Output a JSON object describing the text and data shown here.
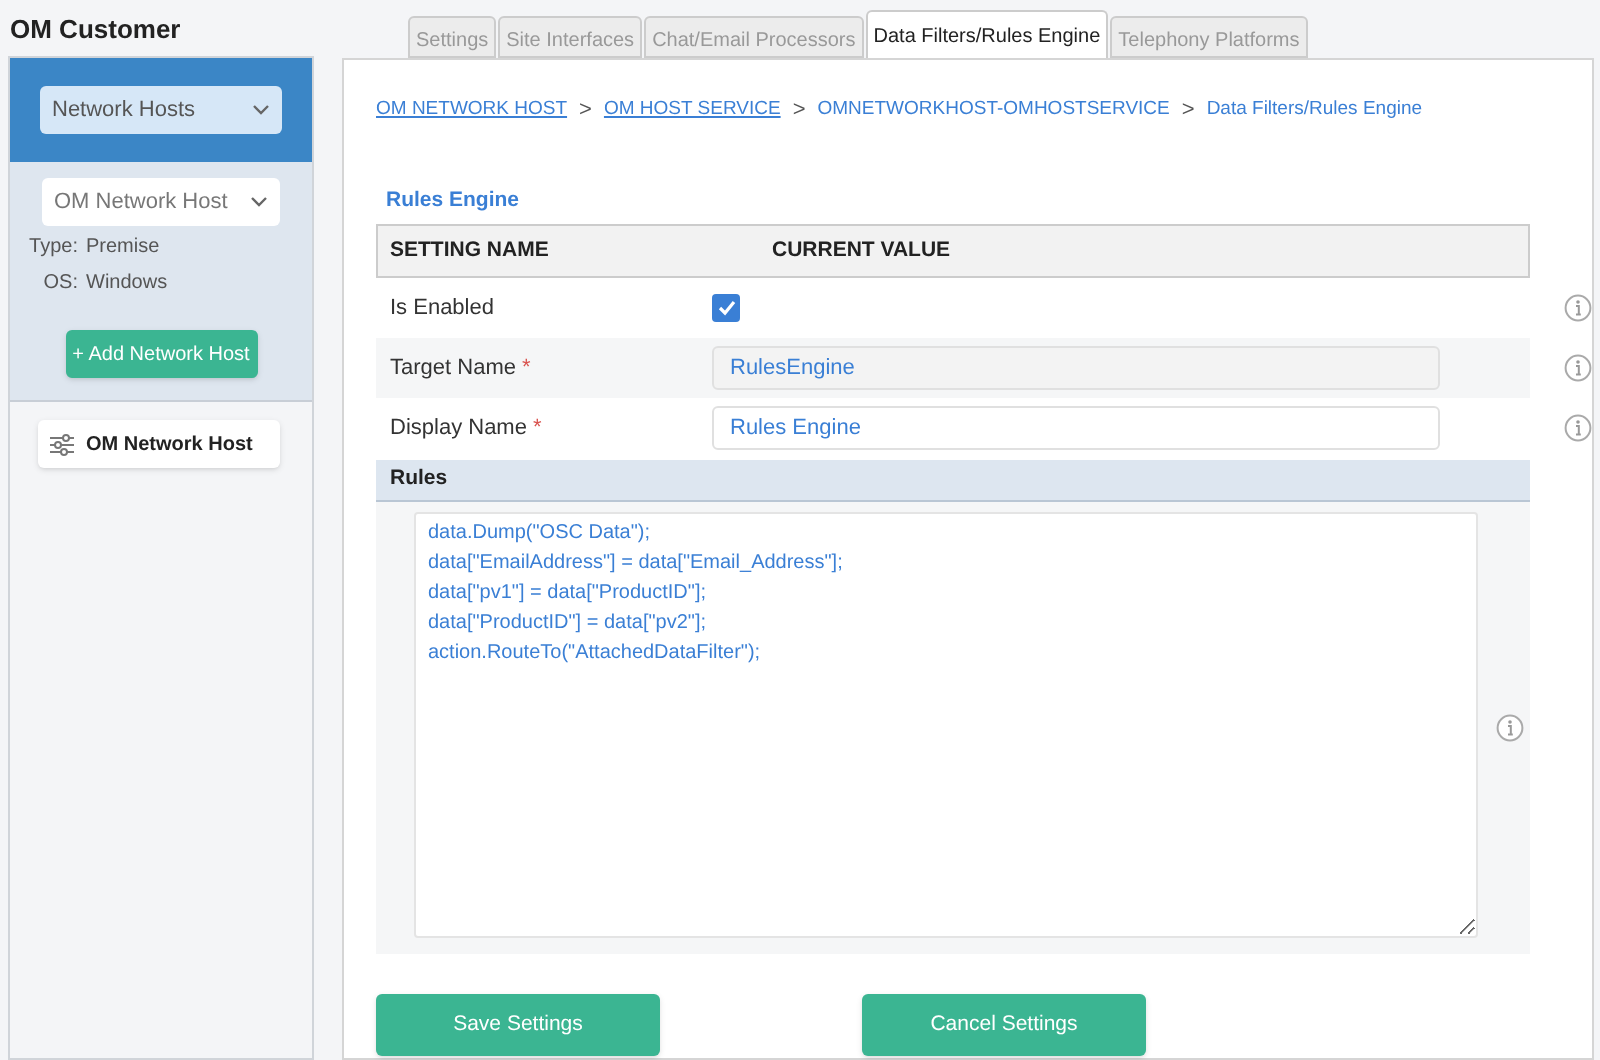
{
  "app_title": "OM Customer",
  "sidebar": {
    "category_select": "Network Hosts",
    "host_select": "OM Network Host",
    "details": [
      {
        "label": "Type:",
        "value": "Premise"
      },
      {
        "label": "OS:",
        "value": "Windows"
      }
    ],
    "add_button": "+ Add Network Host",
    "items": [
      {
        "label": "OM Network Host",
        "selected": true
      }
    ]
  },
  "tabs": [
    {
      "label": "Settings",
      "selected": false
    },
    {
      "label": "Site Interfaces",
      "selected": false
    },
    {
      "label": "Chat/Email Processors",
      "selected": false
    },
    {
      "label": "Data Filters/Rules Engine",
      "selected": true
    },
    {
      "label": "Telephony Platforms",
      "selected": false
    }
  ],
  "breadcrumb": [
    {
      "label": "OM NETWORK HOST",
      "kind": "link"
    },
    {
      "label": ">",
      "kind": "separator"
    },
    {
      "label": "OM HOST SERVICE",
      "kind": "link"
    },
    {
      "label": ">",
      "kind": "separator"
    },
    {
      "label": "OMNETWORKHOST-OMHOSTSERVICE",
      "kind": "text"
    },
    {
      "label": ">",
      "kind": "separator"
    },
    {
      "label": "Data Filters/Rules Engine",
      "kind": "text"
    }
  ],
  "section_title": "Rules Engine",
  "table": {
    "columns": [
      "SETTING NAME",
      "CURRENT VALUE"
    ],
    "rows": [
      {
        "name": "Is Enabled",
        "kind": "checkbox",
        "checked": true
      },
      {
        "name": "Target Name",
        "kind": "readonly",
        "required_mark": "*",
        "value": "RulesEngine"
      },
      {
        "name": "Display Name",
        "kind": "text",
        "required_mark": "*",
        "value": "Rules Engine"
      }
    ]
  },
  "rules": {
    "title": "Rules",
    "value": "data.Dump(\"OSC Data\");\ndata[\"EmailAddress\"] = data[\"Email_Address\"];\ndata[\"pv1\"] = data[\"ProductID\"];\ndata[\"ProductID\"] = data[\"pv2\"];\naction.RouteTo(\"AttachedDataFilter\");"
  },
  "buttons": [
    "Save Settings",
    "Cancel Settings"
  ]
}
